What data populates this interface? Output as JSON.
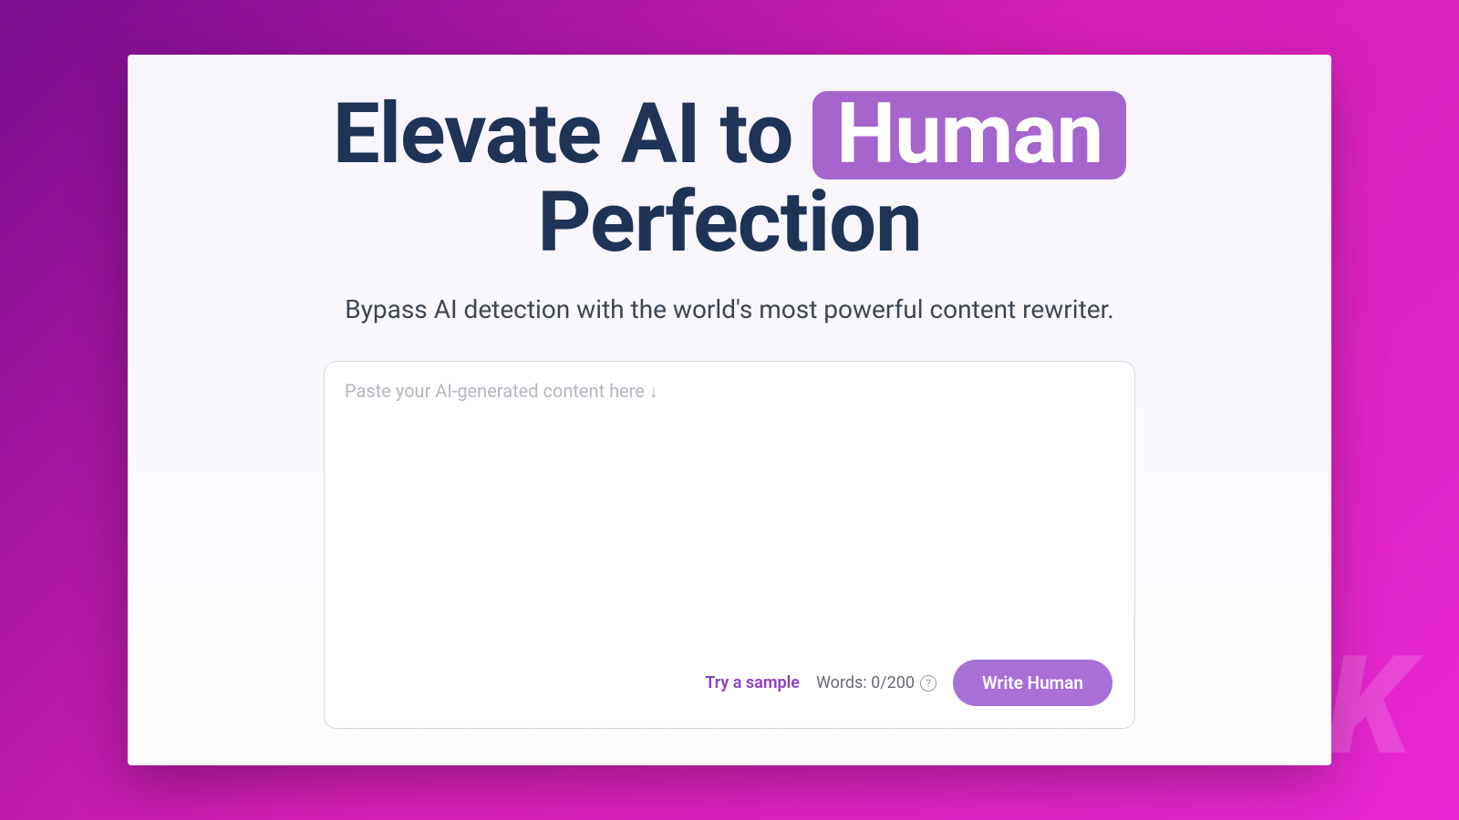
{
  "hero": {
    "headline_part1": "Elevate AI to",
    "headline_highlight": "Human",
    "headline_part2": "Perfection",
    "subtitle": "Bypass AI detection with the world's most powerful content rewriter."
  },
  "editor": {
    "placeholder": "Paste your AI-generated content here ↓",
    "try_sample_label": "Try a sample",
    "word_count_label": "Words: 0/200",
    "submit_label": "Write Human"
  },
  "watermark": {
    "text": "K"
  },
  "colors": {
    "bg_gradient_start": "#7a0d8f",
    "bg_gradient_end": "#e828d4",
    "accent": "#a565cc",
    "heading": "#1e3356",
    "button": "#a870d6"
  }
}
